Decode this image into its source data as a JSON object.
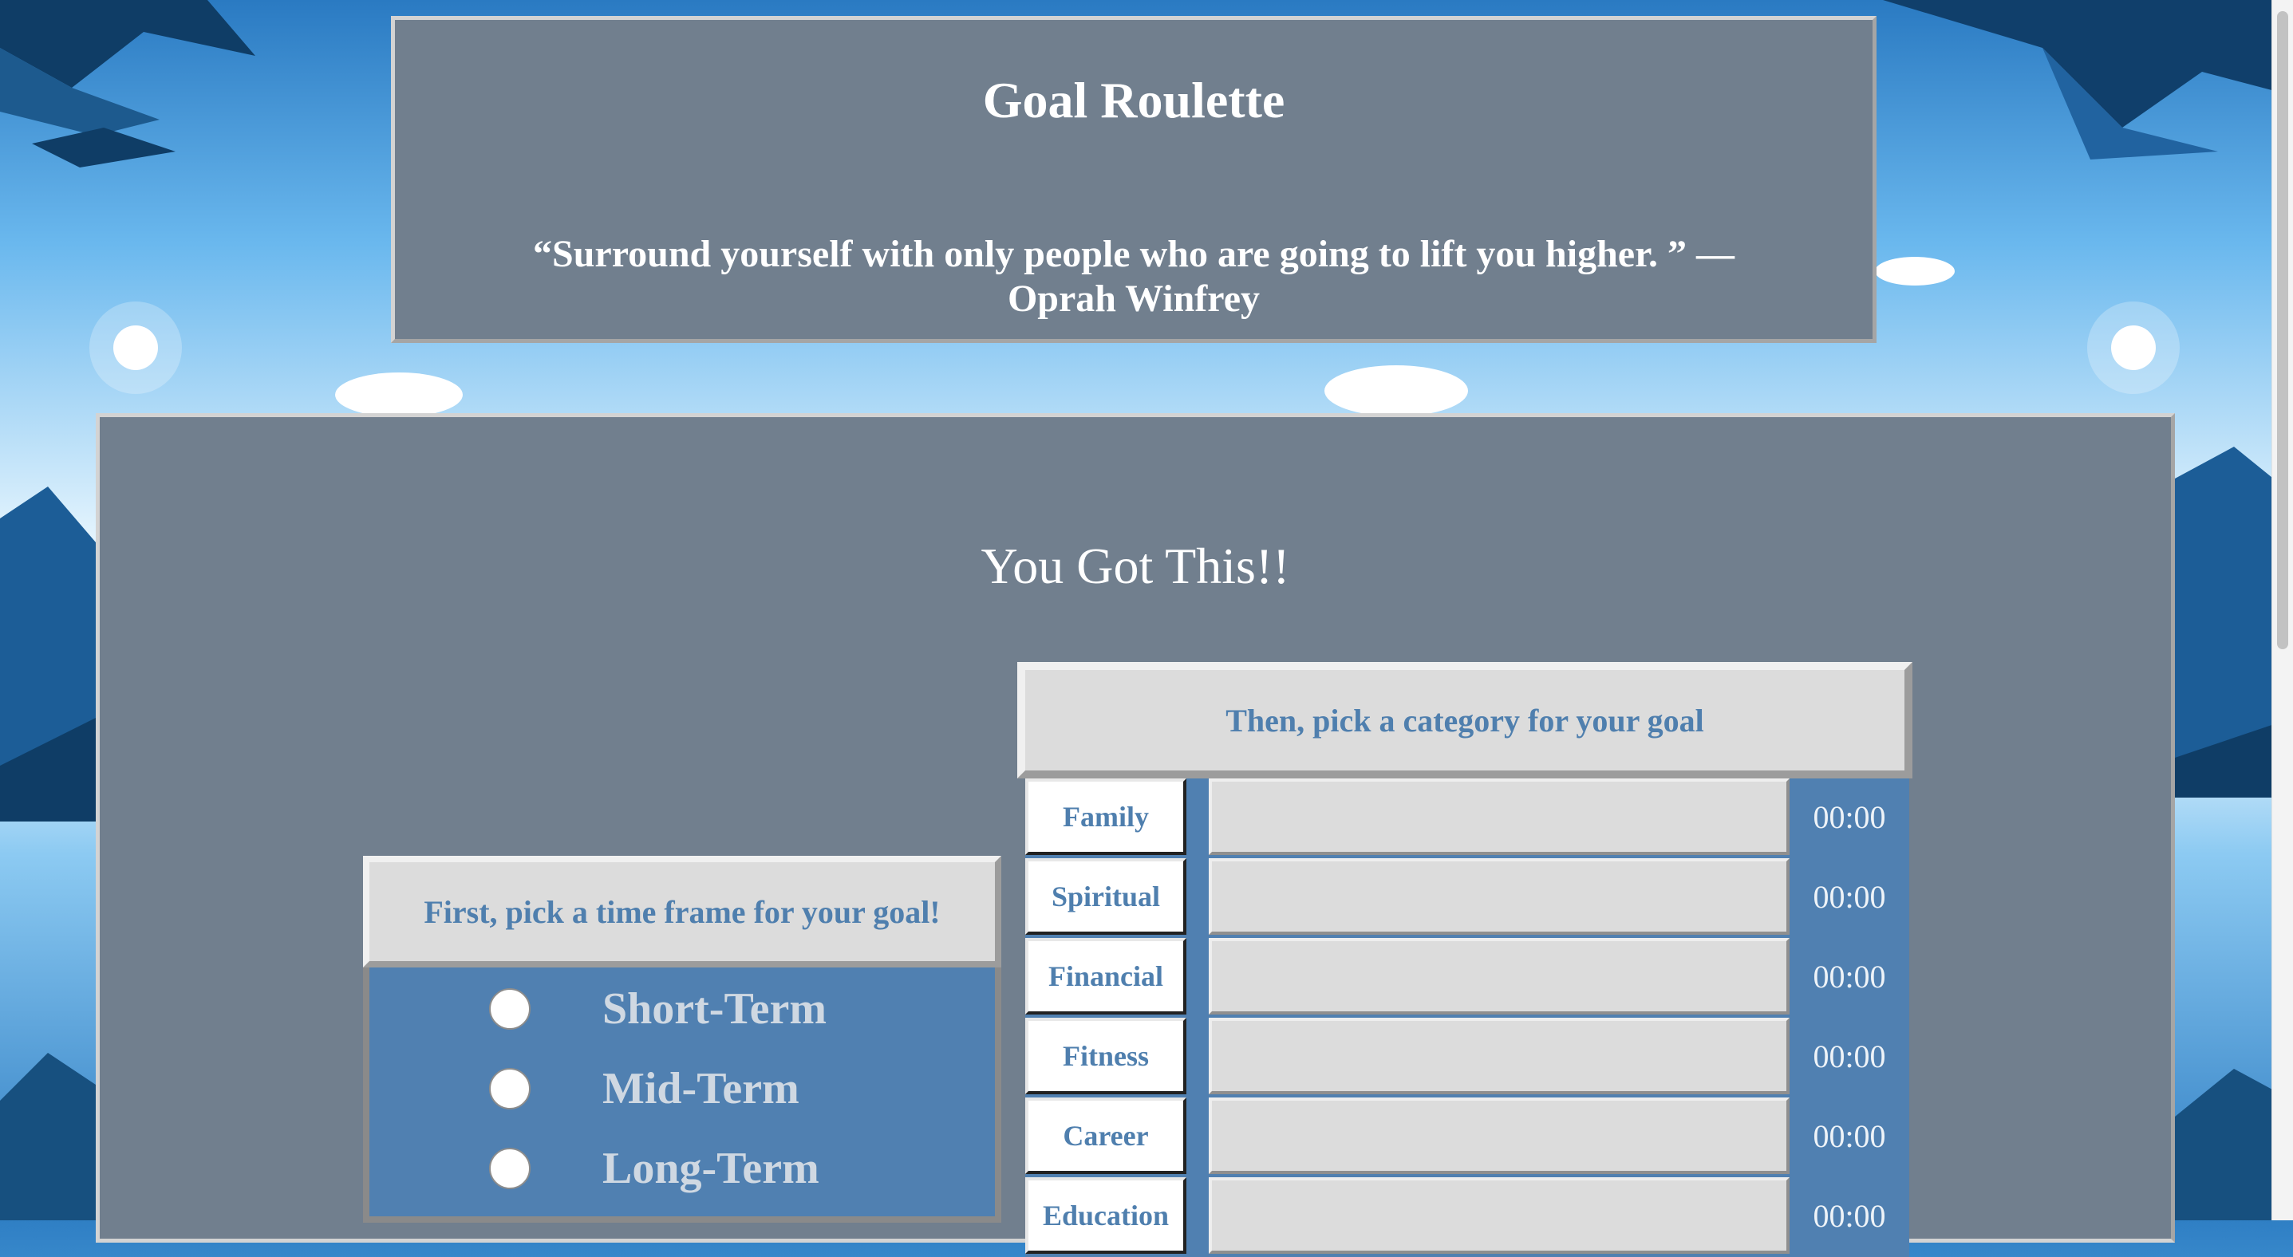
{
  "header": {
    "title": "Goal Roulette",
    "quote": "“Surround yourself with only people who are going to lift you higher. ” — Oprah Winfrey"
  },
  "main": {
    "motto": "You Got This!!",
    "timeframe": {
      "heading": "First, pick a time frame for your goal!",
      "options": [
        {
          "label": "Short-Term",
          "selected": false
        },
        {
          "label": "Mid-Term",
          "selected": false
        },
        {
          "label": "Long-Term",
          "selected": false
        }
      ]
    },
    "categories": {
      "heading": "Then, pick a category for your goal",
      "rows": [
        {
          "label": "Family",
          "value": "",
          "time": "00:00"
        },
        {
          "label": "Spiritual",
          "value": "",
          "time": "00:00"
        },
        {
          "label": "Financial",
          "value": "",
          "time": "00:00"
        },
        {
          "label": "Fitness",
          "value": "",
          "time": "00:00"
        },
        {
          "label": "Career",
          "value": "",
          "time": "00:00"
        },
        {
          "label": "Education",
          "value": "",
          "time": "00:00"
        }
      ]
    }
  },
  "colors": {
    "panel": "#717f8e",
    "accent_blue": "#5080b1",
    "label_blue": "#4f7fae",
    "light_gray": "#dcdcdc"
  }
}
